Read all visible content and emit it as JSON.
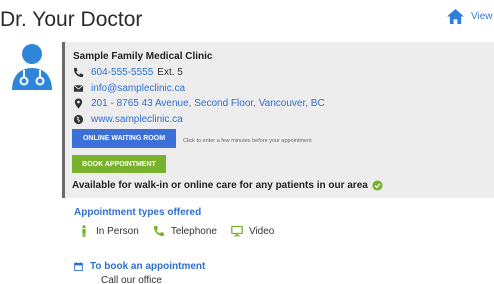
{
  "header": {
    "title": "Dr. Your Doctor",
    "view_label": "View",
    "view_icon": "home-icon"
  },
  "clinic": {
    "name": "Sample Family Medical Clinic",
    "phone": "604-555-5555",
    "extension": "Ext. 5",
    "email": "info@sampleclinic.ca",
    "address": "201 - 8765 43 Avenue, Second Floor, Vancouver, BC",
    "website": "www.sampleclinic.ca",
    "online_waiting_room_label": "ONLINE WAITING ROOM",
    "waiting_room_hint": "Click to enter a few minutes before your appointment",
    "book_appointment_label": "BOOK APPOINTMENT",
    "availability": "Available for walk-in or online care for any patients in our area"
  },
  "appointment_types": {
    "title": "Appointment types offered",
    "items": [
      {
        "label": "In Person",
        "icon": "person-icon"
      },
      {
        "label": "Telephone",
        "icon": "phone-icon"
      },
      {
        "label": "Video",
        "icon": "monitor-icon"
      }
    ]
  },
  "booking": {
    "title": "To book an appointment",
    "text": "Call our office"
  },
  "colors": {
    "accent_blue": "#2f6fcf",
    "button_blue": "#3c6fd8",
    "button_green": "#78b22d",
    "card_bg": "#ededed",
    "avatar_blue": "#2e86d9"
  }
}
